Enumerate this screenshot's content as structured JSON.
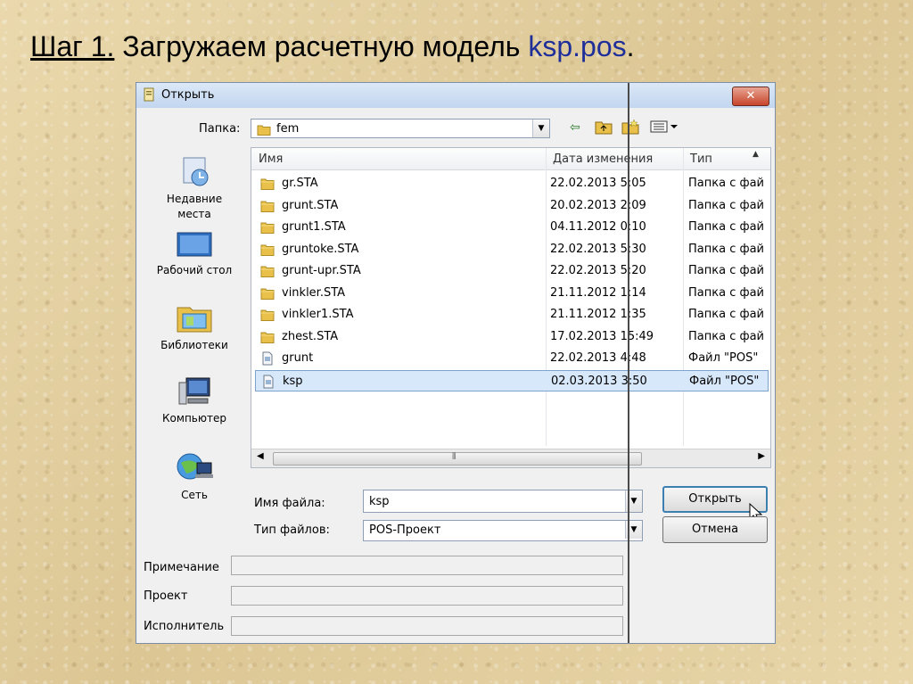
{
  "slide": {
    "step": "Шаг 1.",
    "title_text": "Загружаем расчетную модель",
    "model_name": "ksp.pos",
    "period": "."
  },
  "dialog": {
    "title": "Открыть",
    "close_label": "✕",
    "folder_label": "Папка:",
    "folder_value": "fem",
    "places": [
      {
        "label": "Недавние места",
        "icon": "recent-places-icon"
      },
      {
        "label": "Рабочий стол",
        "icon": "desktop-icon"
      },
      {
        "label": "Библиотеки",
        "icon": "libraries-icon"
      },
      {
        "label": "Компьютер",
        "icon": "computer-icon"
      },
      {
        "label": "Сеть",
        "icon": "network-icon"
      }
    ],
    "columns": {
      "name": "Имя",
      "date": "Дата изменения",
      "type": "Тип"
    },
    "files": [
      {
        "name": "gr.STA",
        "date": "22.02.2013 5:05",
        "type": "Папка с фай",
        "icon": "folder-icon"
      },
      {
        "name": "grunt.STA",
        "date": "20.02.2013 2:09",
        "type": "Папка с фай",
        "icon": "folder-icon"
      },
      {
        "name": "grunt1.STA",
        "date": "04.11.2012 0:10",
        "type": "Папка с фай",
        "icon": "folder-icon"
      },
      {
        "name": "gruntoke.STA",
        "date": "22.02.2013 5:30",
        "type": "Папка с фай",
        "icon": "folder-icon"
      },
      {
        "name": "grunt-upr.STA",
        "date": "22.02.2013 5:20",
        "type": "Папка с фай",
        "icon": "folder-icon"
      },
      {
        "name": "vinkler.STA",
        "date": "21.11.2012 1:14",
        "type": "Папка с фай",
        "icon": "folder-icon"
      },
      {
        "name": "vinkler1.STA",
        "date": "21.11.2012 1:35",
        "type": "Папка с фай",
        "icon": "folder-icon"
      },
      {
        "name": "zhest.STA",
        "date": "17.02.2013 15:49",
        "type": "Папка с фай",
        "icon": "folder-icon"
      },
      {
        "name": "grunt",
        "date": "22.02.2013 4:48",
        "type": "Файл \"POS\"",
        "icon": "file-icon"
      },
      {
        "name": "ksp",
        "date": "02.03.2013 3:50",
        "type": "Файл \"POS\"",
        "icon": "file-icon",
        "selected": true
      }
    ],
    "filename_label": "Имя файла:",
    "filename_value": "ksp",
    "filetype_label": "Тип файлов:",
    "filetype_value": "POS-Проект",
    "open_button": "Открыть",
    "cancel_button": "Отмена",
    "note_label": "Примечание",
    "project_label": "Проект",
    "executor_label": "Исполнитель"
  },
  "colors": {
    "accent": "#1f2f9a",
    "selection": "#d8e8fb"
  }
}
